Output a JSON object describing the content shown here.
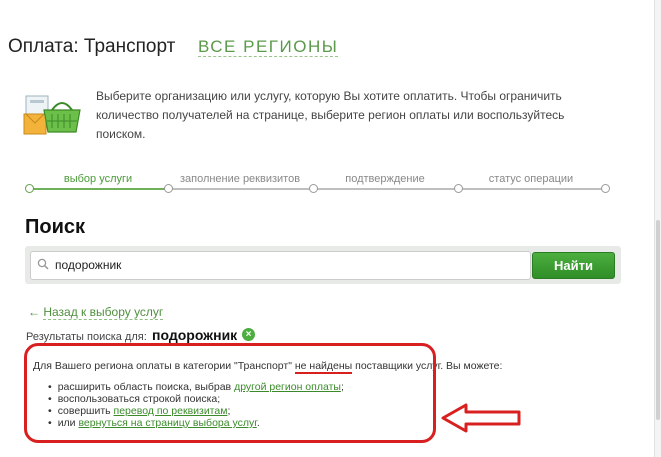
{
  "header": {
    "title": "Оплата: Транспорт",
    "region_link": "ВСЕ РЕГИОНЫ"
  },
  "intro": {
    "icon": "shopping-basket-icon",
    "text": "Выберите организацию или услугу, которую Вы хотите оплатить. Чтобы ограничить количество получателей на странице, выберите регион оплаты или воспользуйтесь поиском."
  },
  "steps": [
    {
      "label": "выбор услуги",
      "active": true
    },
    {
      "label": "заполнение реквизитов",
      "active": false
    },
    {
      "label": "подтверждение",
      "active": false
    },
    {
      "label": "статус операции",
      "active": false
    }
  ],
  "search": {
    "heading": "Поиск",
    "value": "подорожник",
    "button_label": "Найти"
  },
  "back_link": {
    "arrow": "←",
    "label": "Назад к выбору услуг"
  },
  "results": {
    "label": "Результаты поиска для:",
    "query": "подорожник",
    "clear_icon": "×"
  },
  "message": {
    "before": "Для Вашего региона оплаты в категории \"Транспорт\" ",
    "highlight": "не найдены",
    "after": " поставщики услуг. Вы можете:",
    "options": [
      {
        "text": "расширить область поиска, выбрав ",
        "link": "другой регион оплаты",
        "tail": ";"
      },
      {
        "text": "воспользоваться строкой поиска;",
        "link": "",
        "tail": ""
      },
      {
        "text": "совершить ",
        "link": "перевод по реквизитам",
        "tail": ";"
      },
      {
        "text": "или ",
        "link": "вернуться на страницу выбора услуг",
        "tail": "."
      }
    ]
  },
  "colors": {
    "accent_green": "#4cae3f",
    "annotation_red": "#d92020"
  }
}
